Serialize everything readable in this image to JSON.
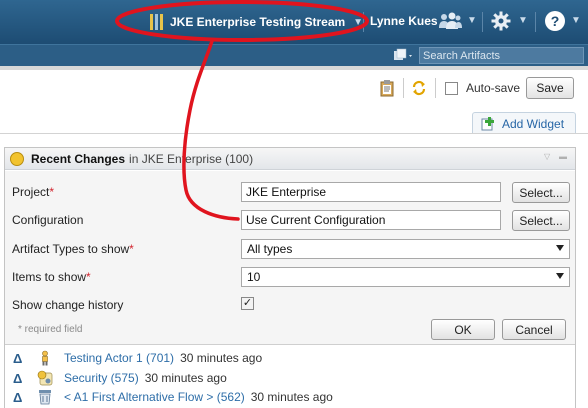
{
  "banner": {
    "stream_name": "JKE Enterprise Testing Stream",
    "user_name": "Lynne Kues",
    "help_glyph": "?"
  },
  "search": {
    "placeholder": "Search Artifacts"
  },
  "toolbar": {
    "autosave_label": "Auto-save",
    "save_label": "Save",
    "add_widget_label": "Add Widget"
  },
  "widget": {
    "title": "Recent Changes",
    "scope": "in JKE Enterprise (100)",
    "fields": {
      "project_label": "Project",
      "project_value": "JKE Enterprise",
      "configuration_label": "Configuration",
      "configuration_value": "Use Current Configuration",
      "artifact_types_label": "Artifact Types to show",
      "artifact_types_value": "All types",
      "items_label": "Items to show",
      "items_value": "10",
      "history_label": "Show change history",
      "history_checked": true
    },
    "required_marker": "*",
    "select_label": "Select...",
    "required_note": "* required field",
    "ok_label": "OK",
    "cancel_label": "Cancel",
    "changes": [
      {
        "link": "Testing Actor 1 (701)",
        "time": "30 minutes ago",
        "icon": "actor-icon"
      },
      {
        "link": "Security (575)",
        "time": "30 minutes ago",
        "icon": "security-requirement-icon"
      },
      {
        "link": "< A1 First Alternative Flow > (562)",
        "time": "30 minutes ago",
        "icon": "flow-icon"
      }
    ]
  },
  "colors": {
    "banner": "#1d4c73",
    "link": "#2e6ea8",
    "required": "#d2242e",
    "annotation": "#e0141e"
  }
}
